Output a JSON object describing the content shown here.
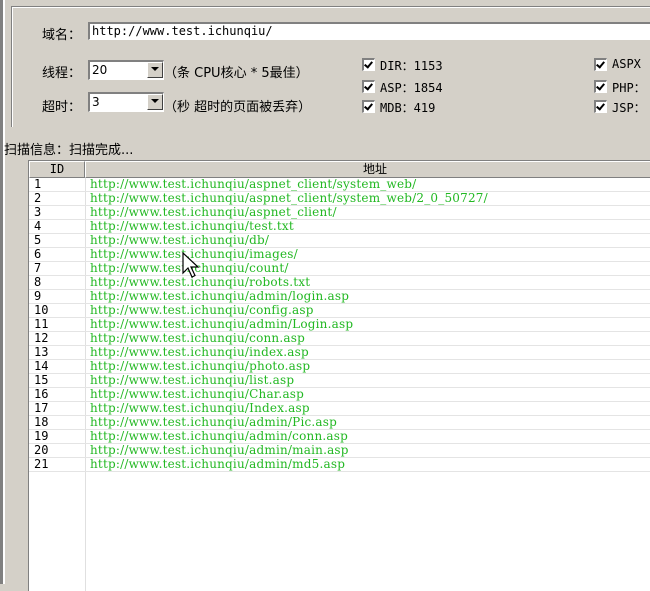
{
  "config": {
    "domain_label": "域名：",
    "domain_value": "http://www.test.ichunqiu/",
    "threads_label": "线程：",
    "threads_value": "20",
    "threads_hint": "（条 CPU核心 * 5最佳）",
    "timeout_label": "超时：",
    "timeout_value": "3",
    "timeout_hint": "（秒 超时的页面被丢弃）",
    "dicts": [
      {
        "label": "DIR：1153",
        "checked": true
      },
      {
        "label": "ASP：1854",
        "checked": true
      },
      {
        "label": "MDB：419",
        "checked": true
      },
      {
        "label": "ASPX",
        "checked": true
      },
      {
        "label": "PHP：",
        "checked": true
      },
      {
        "label": "JSP：",
        "checked": true
      }
    ]
  },
  "status": "扫描信息：扫描完成...",
  "table": {
    "columns": [
      "ID",
      "地址"
    ],
    "rows": [
      {
        "id": "1",
        "url": "http://www.test.ichunqiu/aspnet_client/system_web/"
      },
      {
        "id": "2",
        "url": "http://www.test.ichunqiu/aspnet_client/system_web/2_0_50727/"
      },
      {
        "id": "3",
        "url": "http://www.test.ichunqiu/aspnet_client/"
      },
      {
        "id": "4",
        "url": "http://www.test.ichunqiu/test.txt"
      },
      {
        "id": "5",
        "url": "http://www.test.ichunqiu/db/"
      },
      {
        "id": "6",
        "url": "http://www.test.ichunqiu/images/"
      },
      {
        "id": "7",
        "url": "http://www.test.ichunqiu/count/"
      },
      {
        "id": "8",
        "url": "http://www.test.ichunqiu/robots.txt"
      },
      {
        "id": "9",
        "url": "http://www.test.ichunqiu/admin/login.asp"
      },
      {
        "id": "10",
        "url": "http://www.test.ichunqiu/config.asp"
      },
      {
        "id": "11",
        "url": "http://www.test.ichunqiu/admin/Login.asp"
      },
      {
        "id": "12",
        "url": "http://www.test.ichunqiu/conn.asp"
      },
      {
        "id": "13",
        "url": "http://www.test.ichunqiu/index.asp"
      },
      {
        "id": "14",
        "url": "http://www.test.ichunqiu/photo.asp"
      },
      {
        "id": "15",
        "url": "http://www.test.ichunqiu/list.asp"
      },
      {
        "id": "16",
        "url": "http://www.test.ichunqiu/Char.asp"
      },
      {
        "id": "17",
        "url": "http://www.test.ichunqiu/Index.asp"
      },
      {
        "id": "18",
        "url": "http://www.test.ichunqiu/admin/Pic.asp"
      },
      {
        "id": "19",
        "url": "http://www.test.ichunqiu/admin/conn.asp"
      },
      {
        "id": "20",
        "url": "http://www.test.ichunqiu/admin/main.asp"
      },
      {
        "id": "21",
        "url": "http://www.test.ichunqiu/admin/md5.asp"
      }
    ]
  },
  "colors": {
    "url_text": "#22b822",
    "window_bg": "#d4d0c8"
  }
}
